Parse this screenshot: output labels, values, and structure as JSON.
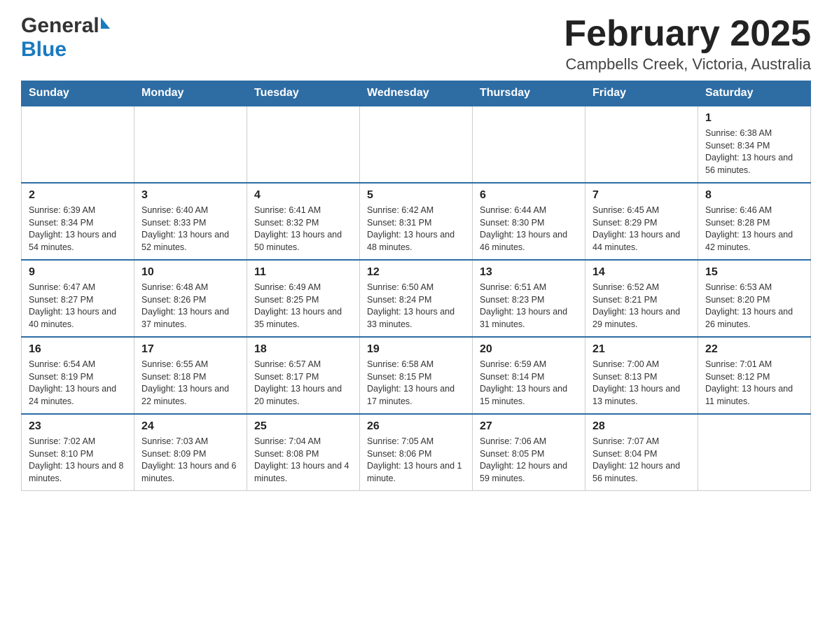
{
  "header": {
    "logo_general": "General",
    "logo_blue": "Blue",
    "month_title": "February 2025",
    "location": "Campbells Creek, Victoria, Australia"
  },
  "days_of_week": [
    "Sunday",
    "Monday",
    "Tuesday",
    "Wednesday",
    "Thursday",
    "Friday",
    "Saturday"
  ],
  "weeks": [
    {
      "days": [
        {
          "number": "",
          "info": ""
        },
        {
          "number": "",
          "info": ""
        },
        {
          "number": "",
          "info": ""
        },
        {
          "number": "",
          "info": ""
        },
        {
          "number": "",
          "info": ""
        },
        {
          "number": "",
          "info": ""
        },
        {
          "number": "1",
          "info": "Sunrise: 6:38 AM\nSunset: 8:34 PM\nDaylight: 13 hours and 56 minutes."
        }
      ]
    },
    {
      "days": [
        {
          "number": "2",
          "info": "Sunrise: 6:39 AM\nSunset: 8:34 PM\nDaylight: 13 hours and 54 minutes."
        },
        {
          "number": "3",
          "info": "Sunrise: 6:40 AM\nSunset: 8:33 PM\nDaylight: 13 hours and 52 minutes."
        },
        {
          "number": "4",
          "info": "Sunrise: 6:41 AM\nSunset: 8:32 PM\nDaylight: 13 hours and 50 minutes."
        },
        {
          "number": "5",
          "info": "Sunrise: 6:42 AM\nSunset: 8:31 PM\nDaylight: 13 hours and 48 minutes."
        },
        {
          "number": "6",
          "info": "Sunrise: 6:44 AM\nSunset: 8:30 PM\nDaylight: 13 hours and 46 minutes."
        },
        {
          "number": "7",
          "info": "Sunrise: 6:45 AM\nSunset: 8:29 PM\nDaylight: 13 hours and 44 minutes."
        },
        {
          "number": "8",
          "info": "Sunrise: 6:46 AM\nSunset: 8:28 PM\nDaylight: 13 hours and 42 minutes."
        }
      ]
    },
    {
      "days": [
        {
          "number": "9",
          "info": "Sunrise: 6:47 AM\nSunset: 8:27 PM\nDaylight: 13 hours and 40 minutes."
        },
        {
          "number": "10",
          "info": "Sunrise: 6:48 AM\nSunset: 8:26 PM\nDaylight: 13 hours and 37 minutes."
        },
        {
          "number": "11",
          "info": "Sunrise: 6:49 AM\nSunset: 8:25 PM\nDaylight: 13 hours and 35 minutes."
        },
        {
          "number": "12",
          "info": "Sunrise: 6:50 AM\nSunset: 8:24 PM\nDaylight: 13 hours and 33 minutes."
        },
        {
          "number": "13",
          "info": "Sunrise: 6:51 AM\nSunset: 8:23 PM\nDaylight: 13 hours and 31 minutes."
        },
        {
          "number": "14",
          "info": "Sunrise: 6:52 AM\nSunset: 8:21 PM\nDaylight: 13 hours and 29 minutes."
        },
        {
          "number": "15",
          "info": "Sunrise: 6:53 AM\nSunset: 8:20 PM\nDaylight: 13 hours and 26 minutes."
        }
      ]
    },
    {
      "days": [
        {
          "number": "16",
          "info": "Sunrise: 6:54 AM\nSunset: 8:19 PM\nDaylight: 13 hours and 24 minutes."
        },
        {
          "number": "17",
          "info": "Sunrise: 6:55 AM\nSunset: 8:18 PM\nDaylight: 13 hours and 22 minutes."
        },
        {
          "number": "18",
          "info": "Sunrise: 6:57 AM\nSunset: 8:17 PM\nDaylight: 13 hours and 20 minutes."
        },
        {
          "number": "19",
          "info": "Sunrise: 6:58 AM\nSunset: 8:15 PM\nDaylight: 13 hours and 17 minutes."
        },
        {
          "number": "20",
          "info": "Sunrise: 6:59 AM\nSunset: 8:14 PM\nDaylight: 13 hours and 15 minutes."
        },
        {
          "number": "21",
          "info": "Sunrise: 7:00 AM\nSunset: 8:13 PM\nDaylight: 13 hours and 13 minutes."
        },
        {
          "number": "22",
          "info": "Sunrise: 7:01 AM\nSunset: 8:12 PM\nDaylight: 13 hours and 11 minutes."
        }
      ]
    },
    {
      "days": [
        {
          "number": "23",
          "info": "Sunrise: 7:02 AM\nSunset: 8:10 PM\nDaylight: 13 hours and 8 minutes."
        },
        {
          "number": "24",
          "info": "Sunrise: 7:03 AM\nSunset: 8:09 PM\nDaylight: 13 hours and 6 minutes."
        },
        {
          "number": "25",
          "info": "Sunrise: 7:04 AM\nSunset: 8:08 PM\nDaylight: 13 hours and 4 minutes."
        },
        {
          "number": "26",
          "info": "Sunrise: 7:05 AM\nSunset: 8:06 PM\nDaylight: 13 hours and 1 minute."
        },
        {
          "number": "27",
          "info": "Sunrise: 7:06 AM\nSunset: 8:05 PM\nDaylight: 12 hours and 59 minutes."
        },
        {
          "number": "28",
          "info": "Sunrise: 7:07 AM\nSunset: 8:04 PM\nDaylight: 12 hours and 56 minutes."
        },
        {
          "number": "",
          "info": ""
        }
      ]
    }
  ]
}
